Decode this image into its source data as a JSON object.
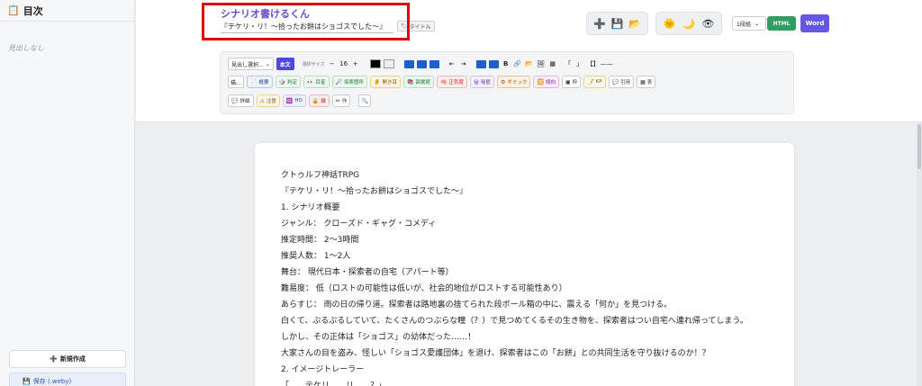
{
  "sidebar": {
    "title": "目次",
    "empty": "見出しなし",
    "new_label": "新規作成",
    "save_label": "保存 (.weby)"
  },
  "header": {
    "app_title": "シナリオ書けるくん",
    "title_value": "『テケリ・リ！～拾ったお餅はショゴスでした～』",
    "title_button": "タイトル",
    "html_label": "HTML",
    "word_label": "Word",
    "view_select": "1段組"
  },
  "toolbar": {
    "heading_select": "見出し選択...",
    "body_button": "本文",
    "size_label": "選択サイズ",
    "size_value": "16",
    "minus": "−",
    "plus": "+",
    "bold": "B",
    "row2": [
      "描…",
      "概要",
      "判定",
      "目星",
      "探索箇所",
      "開き耳",
      "図書館",
      "正気度",
      "秘匿",
      "ギミック",
      "傾向",
      "枠",
      "KP",
      "引用",
      "表"
    ],
    "row3": [
      "詳細",
      "注意",
      "HO",
      "鍵",
      "作"
    ]
  },
  "document": {
    "lines": [
      "クトゥルフ神話TRPG",
      "『テケリ・リ！～拾ったお餅はショゴスでした～』",
      "1. シナリオ概要",
      "ジャンル： クローズド・ギャグ・コメディ",
      "推定時間： 2〜3時間",
      "推奨人数： 1〜2人",
      "舞台： 現代日本・探索者の自宅（アパート等）",
      "難易度： 低（ロストの可能性は低いが、社会的地位がロストする可能性あり）",
      "あらすじ： 雨の日の帰り道。探索者は路地裏の捨てられた段ボール箱の中に、震える「何か」を見つける。",
      "白くて、ぷるぷるしていて、たくさんのつぶらな瞳（？）で見つめてくるその生き物を、探索者はつい自宅へ連れ帰ってしまう。",
      "しかし、その正体は「ショゴス」の幼体だった……！",
      "大家さんの目を盗み、怪しい「ショゴス愛護団体」を退け、探索者はこの「お餅」との共同生活を守り抜けるのか！？",
      "2. イメージトレーラー",
      "「……テケリ……リ……？」"
    ]
  }
}
